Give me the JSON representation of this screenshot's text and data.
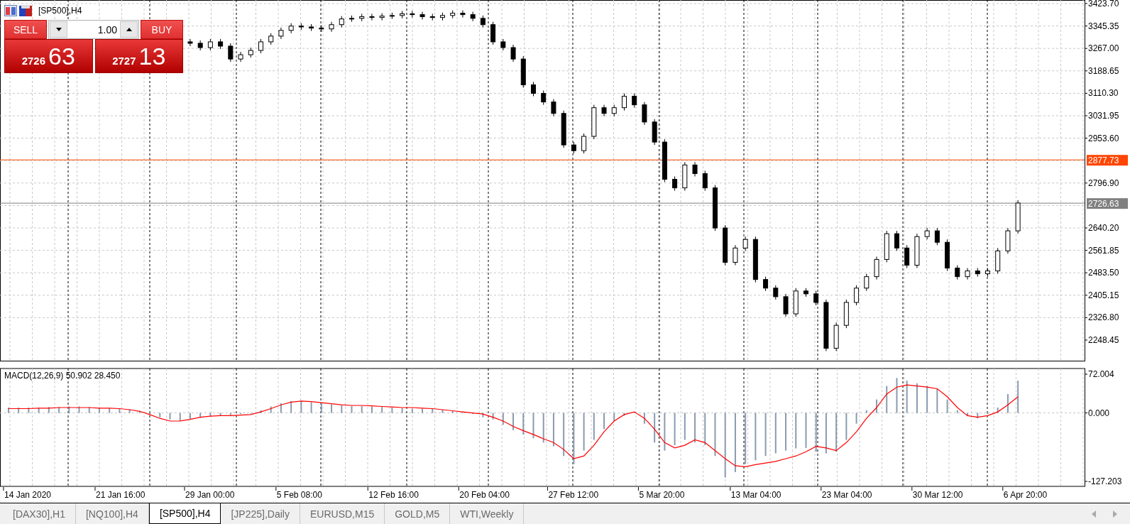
{
  "chart_window": {
    "title": "[SP500],H4"
  },
  "trade_panel": {
    "sell_label": "SELL",
    "buy_label": "BUY",
    "volume": "1.00",
    "sell_price": {
      "big": "2726",
      "small": "63"
    },
    "buy_price": {
      "big": "2727",
      "small": "13"
    }
  },
  "price_axis": {
    "labels": [
      "3423.70",
      "3345.35",
      "3267.00",
      "3188.65",
      "3110.30",
      "3031.95",
      "2953.60",
      "2796.90",
      "2640.20",
      "2561.85",
      "2483.50",
      "2405.15",
      "2326.80",
      "2248.45"
    ],
    "tags": [
      {
        "label": "2877.73",
        "kind": "level"
      },
      {
        "label": "2726.63",
        "kind": "bid"
      }
    ]
  },
  "macd": {
    "label": "MACD(12,26,9) 50.902 28.450",
    "axis_labels": [
      "72.004",
      "0.000",
      "-127.203"
    ]
  },
  "time_axis": {
    "labels": [
      "14 Jan 2020",
      "21 Jan 16:00",
      "29 Jan 00:00",
      "5 Feb 08:00",
      "12 Feb 16:00",
      "20 Feb 04:00",
      "27 Feb 12:00",
      "5 Mar 20:00",
      "13 Mar 04:00",
      "23 Mar 04:00",
      "30 Mar 12:00",
      "6 Apr 20:00"
    ]
  },
  "tabs": [
    {
      "label": "[DAX30],H1",
      "selected": false
    },
    {
      "label": "[NQ100],H4",
      "selected": false
    },
    {
      "label": "[SP500],H4",
      "selected": true
    },
    {
      "label": "[JP225],Daily",
      "selected": false
    },
    {
      "label": "EURUSD,M15",
      "selected": false
    },
    {
      "label": "GOLD,M5",
      "selected": false
    },
    {
      "label": "WTI,Weekly",
      "selected": false
    }
  ]
}
